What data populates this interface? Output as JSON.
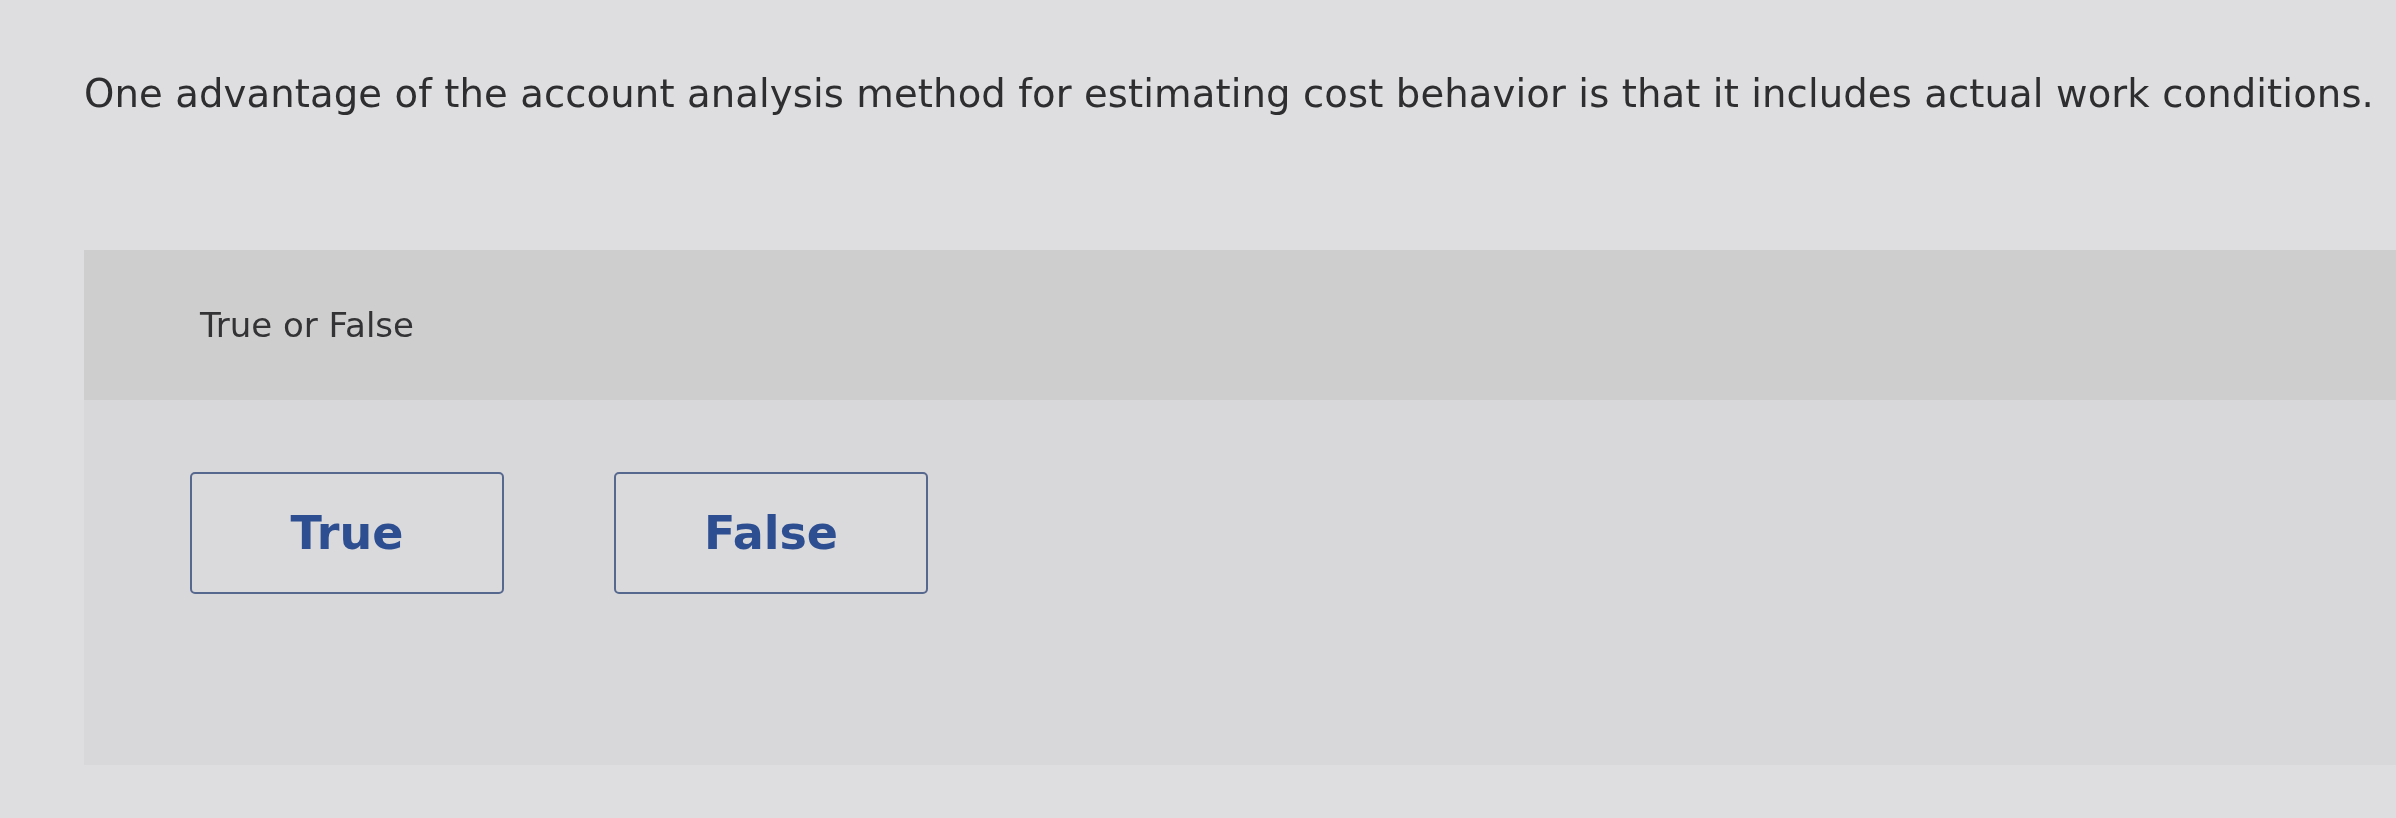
{
  "question": "One advantage of the account analysis method for estimating cost behavior is that it includes actual work conditions.",
  "prompt": "True or False",
  "options": [
    {
      "label": "True",
      "selected": false
    },
    {
      "label": "False",
      "selected": false
    }
  ]
}
